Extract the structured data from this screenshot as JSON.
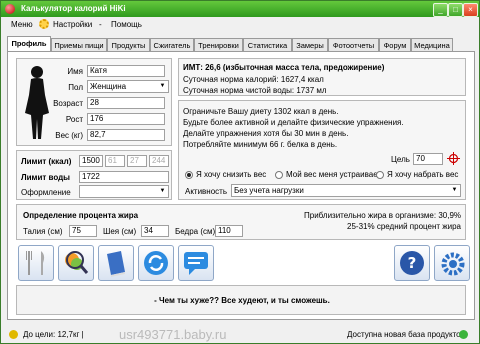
{
  "window": {
    "title": "Калькулятор калорий HiKi",
    "min": "_",
    "max": "□",
    "close": "×"
  },
  "menu": {
    "items": [
      "Меню",
      "Настройки",
      "-",
      "Помощь"
    ]
  },
  "tabs": [
    "Профиль",
    "Приемы пищи",
    "Продукты",
    "Сжигатель",
    "Тренировки",
    "Статистика",
    "Замеры",
    "Фотоотчеты",
    "Форум",
    "Медицина"
  ],
  "profile": {
    "name_label": "Имя",
    "name_value": "Катя",
    "sex_label": "Пол",
    "sex_value": "Женщина",
    "age_label": "Возраст",
    "age_value": "28",
    "height_label": "Рост",
    "height_value": "176",
    "weight_label": "Вес (кг)",
    "weight_value": "82,7"
  },
  "limits": {
    "kcal_label": "Лимит (ккал)",
    "kcal_values": [
      "1500",
      "61",
      "27",
      "244"
    ],
    "water_label": "Лимит воды",
    "water_value": "1722",
    "design_label": "Оформление",
    "design_value": ""
  },
  "bmi": {
    "title": "ИМТ: 26,6 (избыточная масса тела, предожирение)",
    "daily_kcal": "Суточная норма калорий: 1627,4 ккал",
    "daily_water": "Суточная норма чистой воды: 1737 мл"
  },
  "advice": {
    "lines": [
      "Ограничьте Вашу диету 1302 ккал в день.",
      "Будьте более активной и делайте физические упражнения.",
      "Делайте упражнения хотя бы 30 мин в день.",
      "Потребляйте минимум 66 г. белка в день."
    ],
    "goal_label": "Цель",
    "goal_value": "70",
    "radio_lose": "Я хочу снизить вес",
    "radio_keep": "Мой вес меня устраивает",
    "radio_gain": "Я хочу набрать вес",
    "activity_label": "Активность",
    "activity_value": "Без учета нагрузки"
  },
  "fat": {
    "title": "Определение процента жира",
    "waist_label": "Талия (см)",
    "waist_value": "75",
    "neck_label": "Шея (см)",
    "neck_value": "34",
    "hip_label": "Бедра (см)",
    "hip_value": "110",
    "approx": "Приблизительно жира в организме: 30,9%",
    "average": "25-31% средний процент жира"
  },
  "motto": "- Чем ты хуже?? Все худеют, и ты сможешь.",
  "status": {
    "left": "До цели: 12,7кг |",
    "right": "Доступна новая база продуктов",
    "watermark": "usr493771.baby.ru"
  },
  "colors": {
    "titlebar": "#2f9a1e",
    "status_green": "#3cb43c",
    "help_blue": "#2a57a8"
  }
}
